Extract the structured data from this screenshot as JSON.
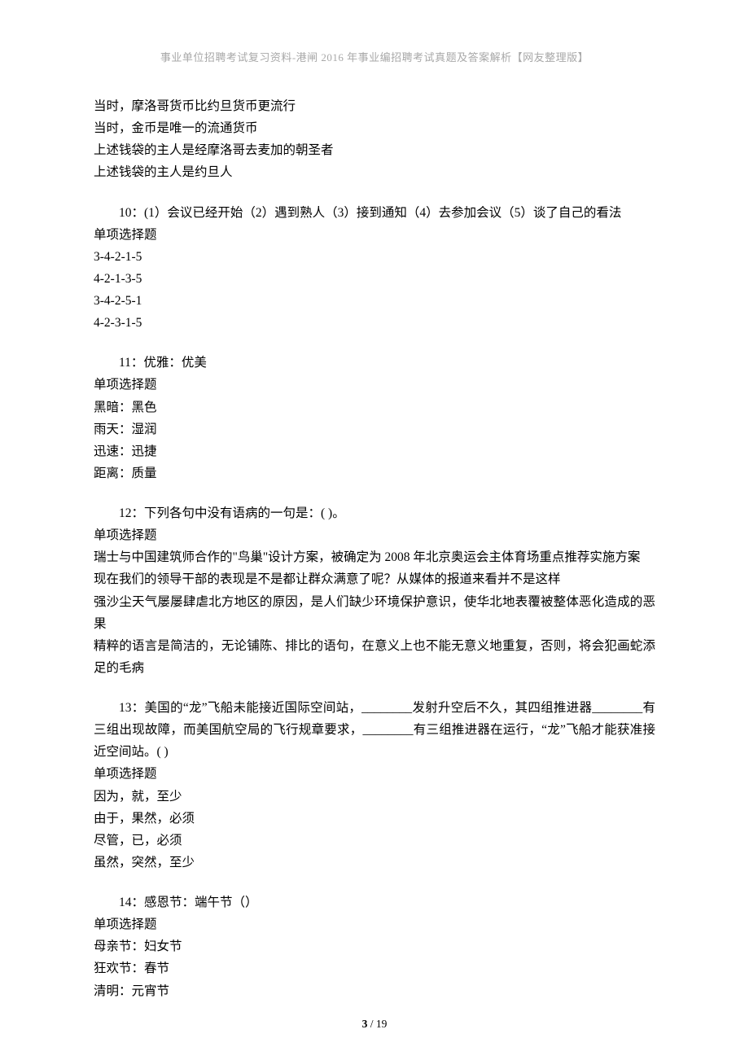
{
  "header": "事业单位招聘考试复习资料-港闸 2016 年事业编招聘考试真题及答案解析【网友整理版】",
  "q9": {
    "opts": [
      "当时，摩洛哥货币比约旦货币更流行",
      "当时，金币是唯一的流通货币",
      "上述钱袋的主人是经摩洛哥去麦加的朝圣者",
      "上述钱袋的主人是约旦人"
    ]
  },
  "q10": {
    "text": "10：(1）会议已经开始（2）遇到熟人（3）接到通知（4）去参加会议（5）谈了自己的看法",
    "type": "单项选择题",
    "opts": [
      "3-4-2-1-5",
      "4-2-1-3-5",
      "3-4-2-5-1",
      "4-2-3-1-5"
    ]
  },
  "q11": {
    "text": "11：优雅：优美",
    "type": "单项选择题",
    "opts": [
      "黑暗：黑色",
      "雨天：湿润",
      "迅速：迅捷",
      "距离：质量"
    ]
  },
  "q12": {
    "text": "12：下列各句中没有语病的一句是：(   )。",
    "type": "单项选择题",
    "opts": [
      "瑞士与中国建筑师合作的\"鸟巢\"设计方案，被确定为 2008 年北京奥运会主体育场重点推荐实施方案",
      "现在我们的领导干部的表现是不是都让群众满意了呢？从媒体的报道来看并不是这样",
      "强沙尘天气屡屡肆虐北方地区的原因，是人们缺少环境保护意识，使华北地表覆被整体恶化造成的恶果",
      "精粹的语言是简洁的，无论铺陈、排比的语句，在意义上也不能无意义地重复，否则，将会犯画蛇添足的毛病"
    ]
  },
  "q13": {
    "text": "13：美国的“龙”飞船未能接近国际空间站，________发射升空后不久，其四组推进器________有三组出现故障，而美国航空局的飞行规章要求，________有三组推进器在运行，“龙”飞船才能获准接近空间站。(   )",
    "type": "单项选择题",
    "opts": [
      "因为，就，至少",
      "由于，果然，必须",
      "尽管，已，必须",
      "虽然，突然，至少"
    ]
  },
  "q14": {
    "text": "14：感恩节：端午节（）",
    "type": "单项选择题",
    "opts": [
      "母亲节：妇女节",
      "狂欢节：春节",
      "清明：元宵节"
    ]
  },
  "footer": {
    "current": "3",
    "sep": " / ",
    "total": "19"
  }
}
